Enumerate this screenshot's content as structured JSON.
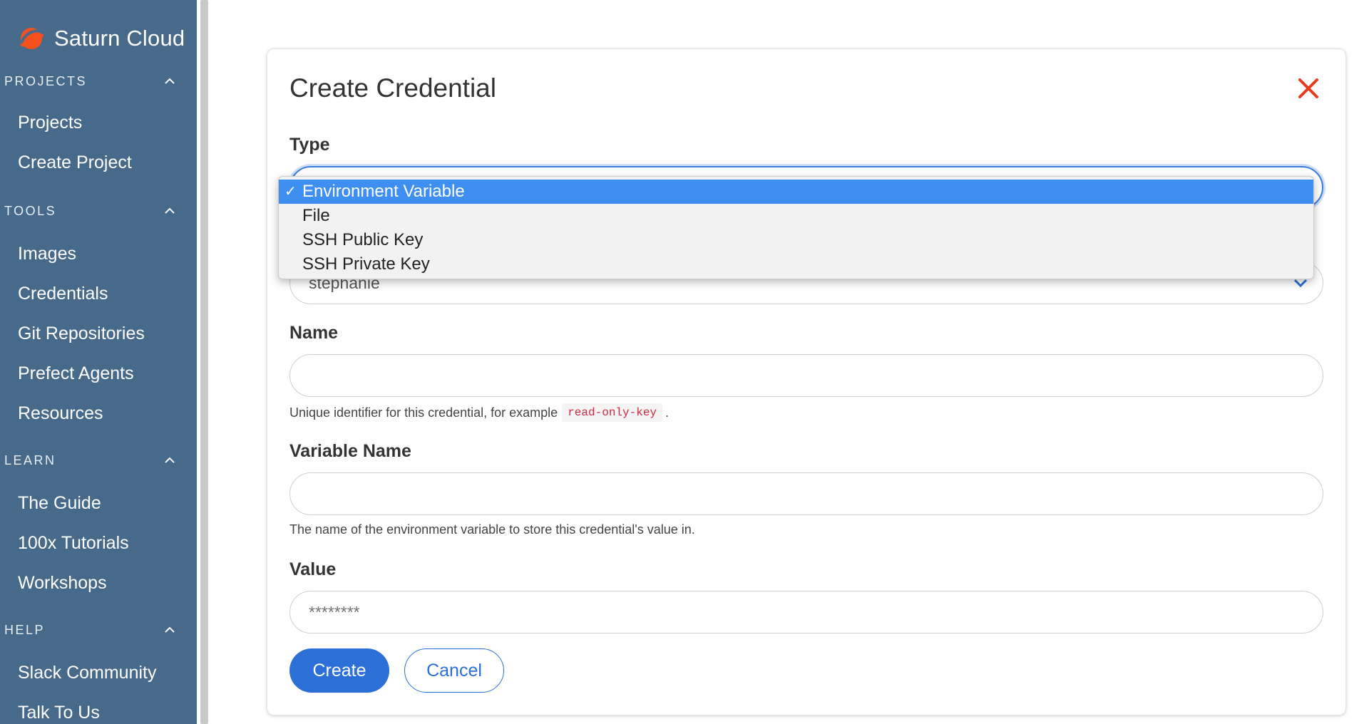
{
  "brand": {
    "name": "Saturn Cloud",
    "logo_color": "#f4511e"
  },
  "sidebar": {
    "background": "#47698a",
    "sections": [
      {
        "title": "PROJECTS",
        "items": [
          "Projects",
          "Create Project"
        ]
      },
      {
        "title": "TOOLS",
        "items": [
          "Images",
          "Credentials",
          "Git Repositories",
          "Prefect Agents",
          "Resources"
        ]
      },
      {
        "title": "LEARN",
        "items": [
          "The Guide",
          "100x Tutorials",
          "Workshops"
        ]
      },
      {
        "title": "HELP",
        "items": [
          "Slack Community",
          "Talk To Us"
        ]
      }
    ]
  },
  "dialog": {
    "title": "Create Credential",
    "close_color": "#e53c1c",
    "type_label": "Type",
    "owner_value": "stephanie",
    "name_label": "Name",
    "name_help_prefix": "Unique identifier for this credential, for example",
    "name_help_code": "read-only-key",
    "name_help_suffix": ".",
    "variable_label": "Variable Name",
    "variable_help": "The name of the environment variable to store this credential's value in.",
    "value_label": "Value",
    "value_placeholder": "********",
    "create_label": "Create",
    "cancel_label": "Cancel",
    "accent_color": "#2c6fd6"
  },
  "type_dropdown": {
    "options": [
      "Environment Variable",
      "File",
      "SSH Public Key",
      "SSH Private Key"
    ],
    "selected": "Environment Variable",
    "check_mark": "✓",
    "highlight_color": "#3f8ff3"
  }
}
